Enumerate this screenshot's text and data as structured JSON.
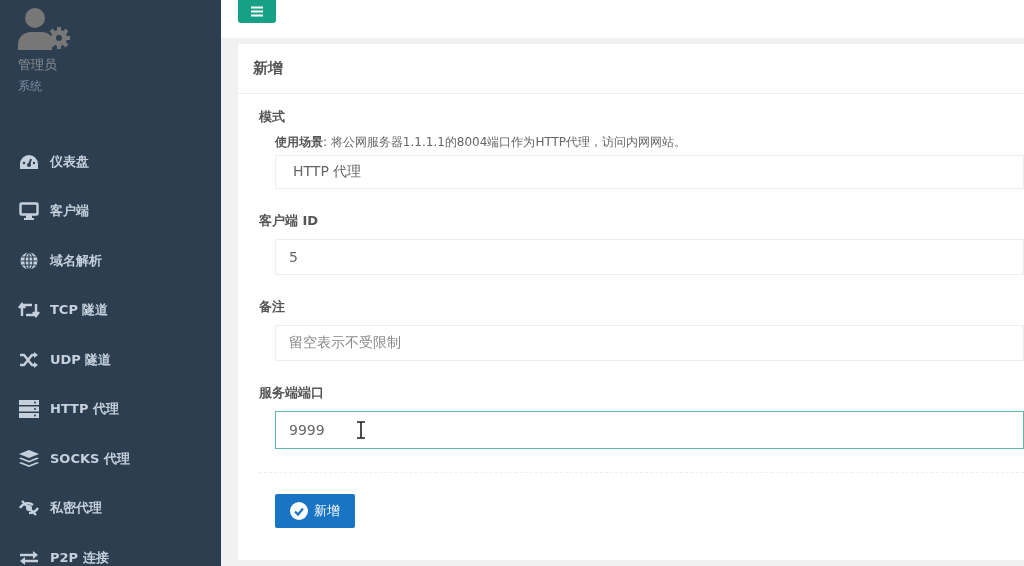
{
  "sidebar": {
    "user": {
      "name": "管理员",
      "role": "系统"
    },
    "items": [
      {
        "label": "仪表盘"
      },
      {
        "label": "客户端"
      },
      {
        "label": "域名解析"
      },
      {
        "label": "TCP 隧道"
      },
      {
        "label": "UDP 隧道"
      },
      {
        "label": "HTTP 代理"
      },
      {
        "label": "SOCKS 代理"
      },
      {
        "label": "私密代理"
      },
      {
        "label": "P2P 连接"
      }
    ]
  },
  "form": {
    "title": "新增",
    "fields": [
      {
        "kind": "select",
        "label": "模式",
        "help": "**使用场景**: 将公网服务器1.1.1.1的8004端口作为HTTP代理，访问内网网站。",
        "value": "HTTP 代理",
        "focused": false
      },
      {
        "kind": "input",
        "label": "客户端 ID",
        "value": "5",
        "focused": false
      },
      {
        "kind": "input",
        "label": "备注",
        "placeholder": "留空表示不受限制",
        "focused": false
      },
      {
        "kind": "input",
        "label": "服务端端口",
        "value": "9999",
        "focused": true
      }
    ],
    "submit": "新增"
  }
}
